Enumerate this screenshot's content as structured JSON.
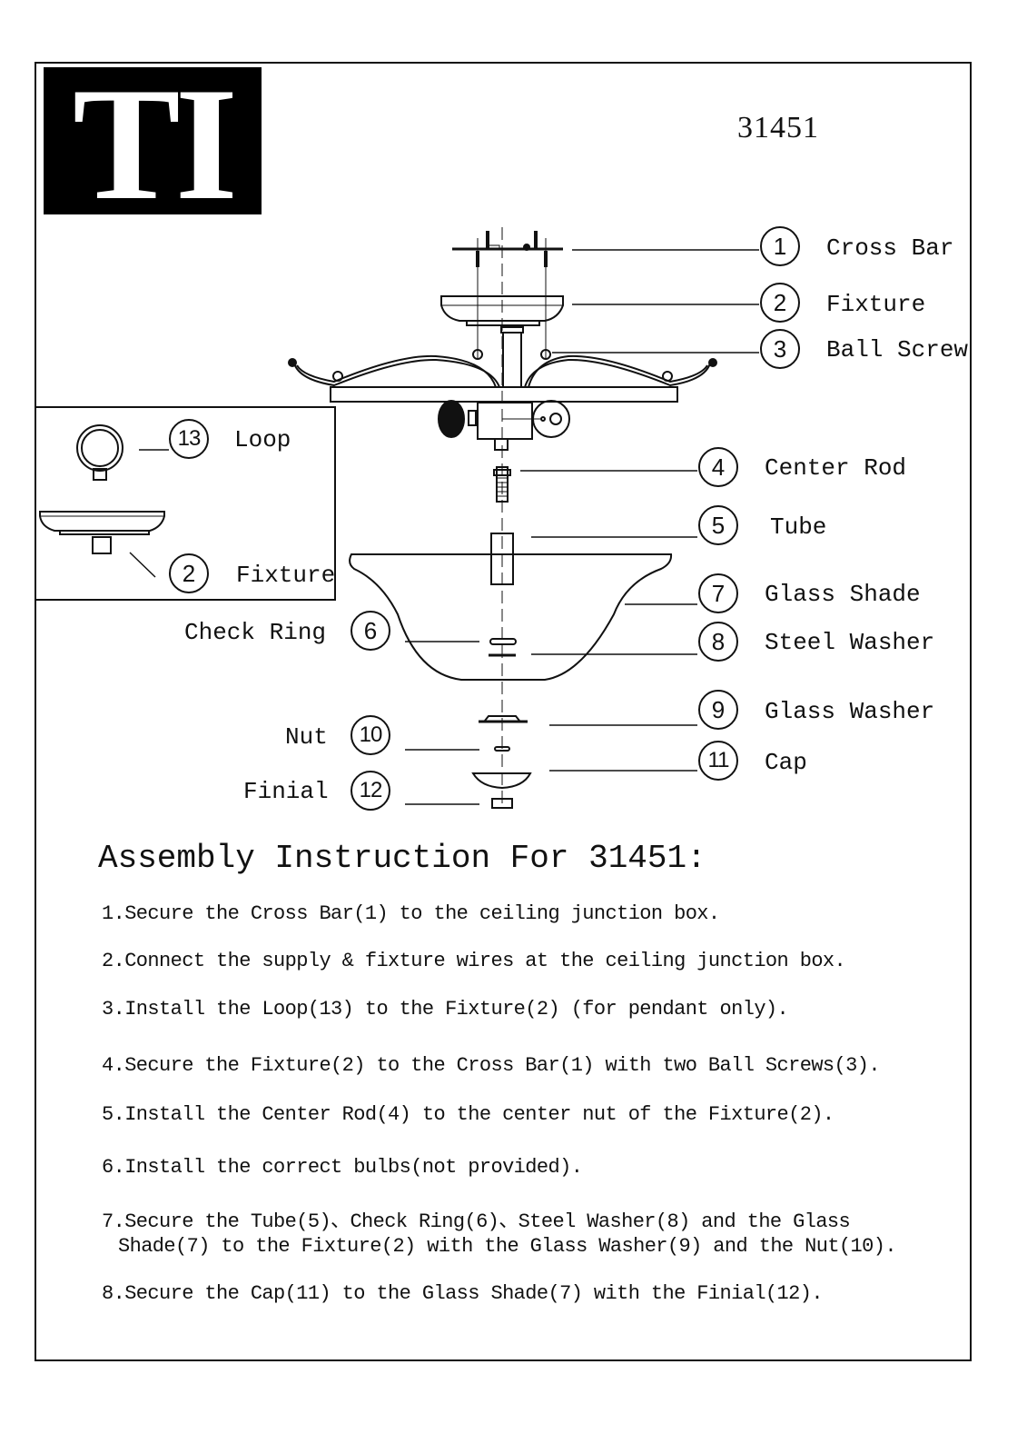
{
  "header": {
    "logo_text": "TI",
    "model_number": "31451"
  },
  "parts": [
    {
      "num": "1",
      "name": "Cross Bar"
    },
    {
      "num": "2",
      "name": "Fixture"
    },
    {
      "num": "3",
      "name": "Ball Screw"
    },
    {
      "num": "4",
      "name": "Center Rod"
    },
    {
      "num": "5",
      "name": "Tube"
    },
    {
      "num": "6",
      "name": "Check Ring"
    },
    {
      "num": "7",
      "name": "Glass Shade"
    },
    {
      "num": "8",
      "name": "Steel Washer"
    },
    {
      "num": "9",
      "name": "Glass Washer"
    },
    {
      "num": "10",
      "name": "Nut"
    },
    {
      "num": "11",
      "name": "Cap"
    },
    {
      "num": "12",
      "name": "Finial"
    },
    {
      "num": "13",
      "name": "Loop"
    }
  ],
  "inset": {
    "loop": {
      "num": "13",
      "name": "Loop"
    },
    "fixture": {
      "num": "2",
      "name": "Fixture"
    }
  },
  "instructions": {
    "title": "Assembly Instruction For 31451:",
    "steps": [
      "1.Secure the Cross Bar(1) to the ceiling junction box.",
      "2.Connect the supply & fixture wires at the ceiling junction box.",
      "3.Install the Loop(13) to the Fixture(2) (for pendant only).",
      "4.Secure the Fixture(2) to the Cross Bar(1) with two Ball Screws(3).",
      "5.Install the Center Rod(4) to the center nut of the Fixture(2).",
      "6.Install the correct bulbs(not provided).",
      "7.Secure the Tube(5)、Check Ring(6)、Steel Washer(8) and the Glass",
      "Shade(7) to the Fixture(2) with the Glass Washer(9) and the Nut(10).",
      "8.Secure the Cap(11) to the Glass Shade(7) with the Finial(12)."
    ]
  }
}
